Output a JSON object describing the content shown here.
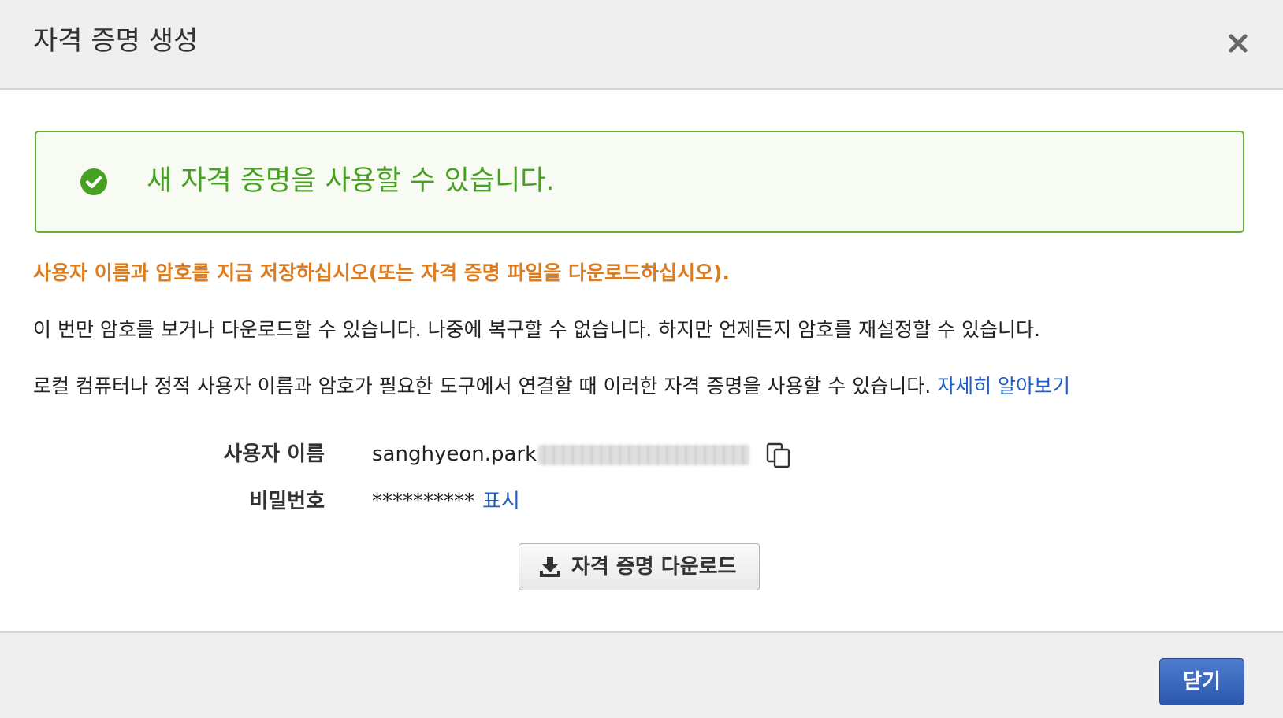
{
  "header": {
    "title": "자격 증명 생성",
    "close_icon": "close-icon"
  },
  "alert": {
    "icon": "check-circle-icon",
    "message": "새 자격 증명을 사용할 수 있습니다.",
    "color": "#48a023"
  },
  "warning": {
    "text": "사용자 이름과 암호를 지금 저장하십시오(또는 자격 증명 파일을 다운로드하십시오).",
    "color": "#dd7b1f"
  },
  "info": {
    "line1": "이 번만 암호를 보거나 다운로드할 수 있습니다. 나중에 복구할 수 없습니다. 하지만 언제든지 암호를 재설정할 수 있습니다.",
    "line2": "로컬 컴퓨터나 정적 사용자 이름과 암호가 필요한 도구에서 연결할 때 이러한 자격 증명을 사용할 수 있습니다.",
    "learn_more_link": "자세히 알아보기"
  },
  "credentials": {
    "username_label": "사용자 이름",
    "username_value": "sanghyeon.park",
    "copy_icon": "copy-icon",
    "password_label": "비밀번호",
    "password_mask": "**********",
    "show_link": "표시"
  },
  "download_button": {
    "icon": "download-icon",
    "label": "자격 증명 다운로드"
  },
  "footer": {
    "close_label": "닫기",
    "accent": "#2b58ad"
  }
}
